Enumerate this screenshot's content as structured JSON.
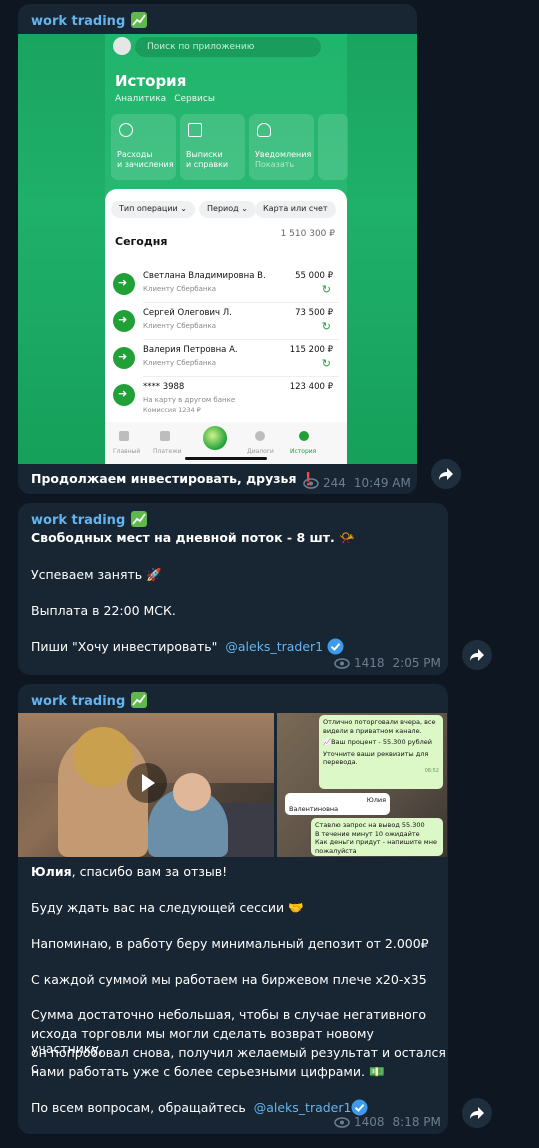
{
  "channel": {
    "sender": "work trading",
    "forward_icon": "forward-arrow-icon",
    "view_icon": "eye-icon"
  },
  "messages": [
    {
      "text": "Продолжаем инвестировать, друзья",
      "views": "244",
      "time": "10:49 AM"
    },
    {
      "line1": "Свободных мест на дневной поток - 8 шт.",
      "line2": "Успеваем занять",
      "line3": "Выплата в 22:00 МСК.",
      "line4_prefix": "Пиши \"Хочу инвестировать\"",
      "link": "@aleks_trader1",
      "views": "1418",
      "time": "2:05 PM"
    },
    {
      "name": "Юлия",
      "line1_rest": ", спасибо вам за отзыв!",
      "line2": "Буду ждать вас на следующей сессии",
      "line3": "Напоминаю, в работу беру минимальный депозит от 2.000₽",
      "line4": "С каждой суммой мы работаем на биржевом плече х20-х35",
      "line5a": "Сумма достаточно небольшая, чтобы в случае негативного",
      "line5b": "исхода торговли мы могли сделать возврат новому участнику,",
      "line5c": "он попробовал снова, получил желаемый результат и остался с",
      "line5d": "нами работать уже с более серьезными цифрами.",
      "line6_prefix": "По всем вопросам, обращайтесь",
      "link": "@aleks_trader1",
      "views": "1408",
      "time": "8:18 PM"
    }
  ],
  "phone": {
    "search_placeholder": "Поиск по приложению",
    "title": "История",
    "tabs": [
      "Аналитика",
      "Сервисы"
    ],
    "tiles": [
      {
        "l1": "Расходы",
        "l2": "и зачисления"
      },
      {
        "l1": "Выписки",
        "l2": "и справки"
      },
      {
        "l1": "Уведомления",
        "l2": "Показать"
      }
    ],
    "filters": [
      "Тип операции ⌄",
      "Период ⌄",
      "Карта или счет"
    ],
    "today": "Сегодня",
    "total": "1 510 300 ₽",
    "transactions": [
      {
        "name": "Светлана Владимировна В.",
        "sub": "Клиенту Сбербанка",
        "amount": "55 000 ₽"
      },
      {
        "name": "Сергей Олегович Л.",
        "sub": "Клиенту Сбербанка",
        "amount": "73 500 ₽"
      },
      {
        "name": "Валерия Петровна А.",
        "sub": "Клиенту Сбербанка",
        "amount": "115 200 ₽"
      },
      {
        "name": "**** 3988",
        "sub": "На карту в другом банке",
        "sub2": "Комиссия 1234 ₽",
        "amount": "123 400 ₽"
      }
    ],
    "tabbar": [
      "Главный",
      "Платежи",
      "Диалоги",
      "История"
    ]
  },
  "collage": {
    "b1": "Отлично поторговали вчера, все видели в приватном канале.",
    "b2": "📈Ваш процент - 55.300 рублей",
    "b3": "Уточните ваши реквизиты для перевода.",
    "b4": "Юлия",
    "b5": "Валентиновна",
    "b6": "Ставлю запрос на вывод 55.300",
    "b7": "В течение минут 10 ожидайте",
    "b8": "Как деньги придут - напишите мне пожалуйста",
    "t1": "08:52",
    "t2": "08:53",
    "t3": "08:54",
    "t4": "08:54"
  }
}
